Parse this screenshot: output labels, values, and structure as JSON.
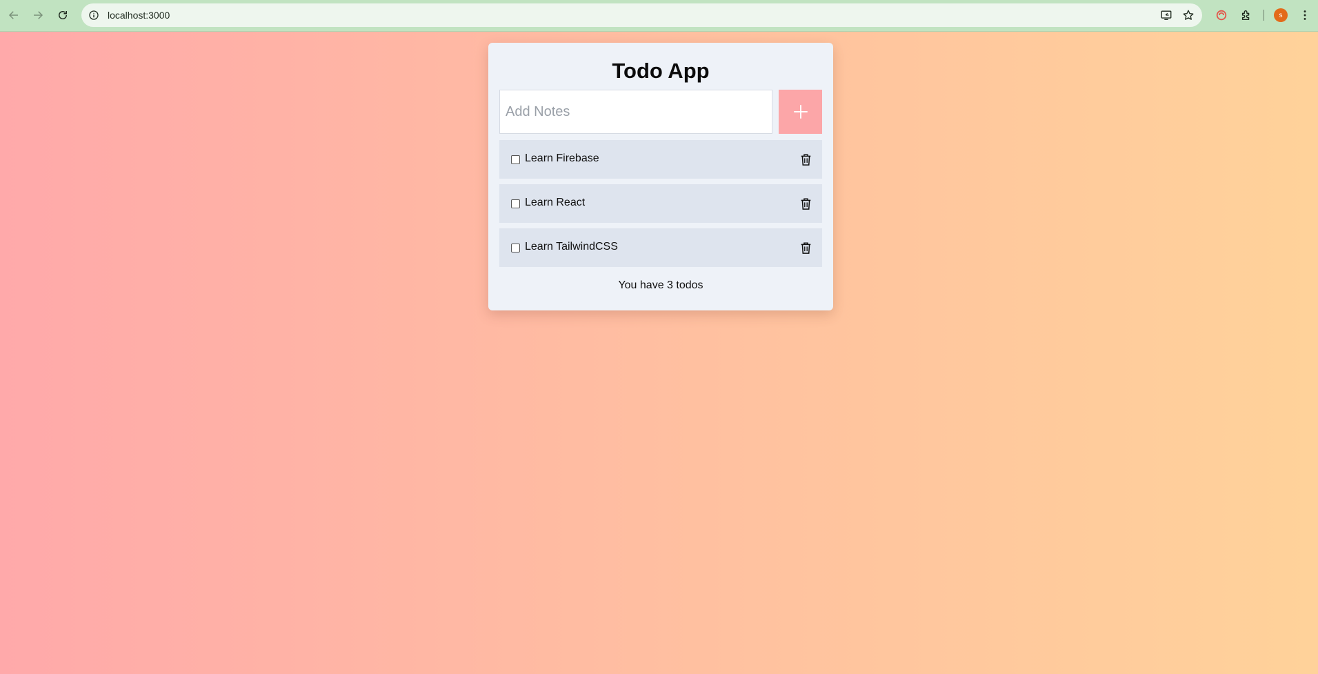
{
  "browser": {
    "url": "localhost:3000",
    "profile_initial": "s"
  },
  "app": {
    "title": "Todo App",
    "input_placeholder": "Add Notes",
    "input_value": "",
    "add_button_icon": "plus-icon",
    "todos": [
      {
        "label": "Learn Firebase",
        "checked": false
      },
      {
        "label": "Learn React",
        "checked": false
      },
      {
        "label": "Learn TailwindCSS",
        "checked": false
      }
    ],
    "count_text": "You have 3 todos"
  },
  "colors": {
    "chrome_bg": "#c1e3c1",
    "card_bg": "#eef2f8",
    "todo_bg": "#dee4ee",
    "add_button": "#fca6a8",
    "gradient_start": "#ffa9aa",
    "gradient_end": "#ffd29a"
  }
}
